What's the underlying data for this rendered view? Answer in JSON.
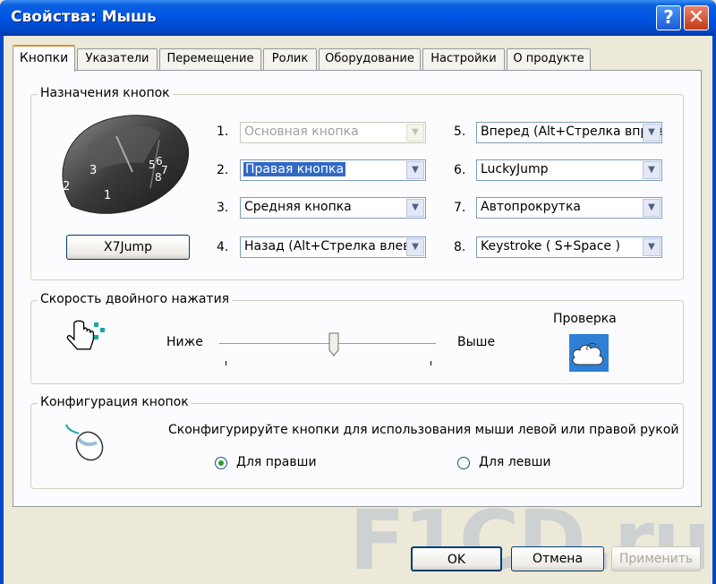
{
  "window": {
    "title": "Свойства: Мышь",
    "help_glyph": "?",
    "close_glyph": "✕"
  },
  "tabs": [
    {
      "label": "Кнопки",
      "active": true
    },
    {
      "label": "Указатели"
    },
    {
      "label": "Перемещение"
    },
    {
      "label": "Ролик"
    },
    {
      "label": "Оборудование"
    },
    {
      "label": "Настройки"
    },
    {
      "label": "О продукте"
    }
  ],
  "button_assignment": {
    "group_label": "Назначения кнопок",
    "mouse_image_labels": [
      "1",
      "2",
      "3",
      "5",
      "6",
      "7",
      "8"
    ],
    "profile_button": "X7Jump",
    "slots": [
      {
        "number": "1.",
        "value": "Основная кнопка",
        "state": "disabled"
      },
      {
        "number": "2.",
        "value": "Правая кнопка",
        "state": "selected"
      },
      {
        "number": "3.",
        "value": "Средняя кнопка",
        "state": "normal"
      },
      {
        "number": "4.",
        "value": "Назад (Alt+Стрелка влево)",
        "state": "normal"
      },
      {
        "number": "5.",
        "value": "Вперед (Alt+Стрелка вправо)",
        "state": "normal"
      },
      {
        "number": "6.",
        "value": "LuckyJump",
        "state": "normal"
      },
      {
        "number": "7.",
        "value": "Автопрокрутка",
        "state": "normal"
      },
      {
        "number": "8.",
        "value": "Keystroke ( S+Space )",
        "state": "normal"
      }
    ]
  },
  "double_click": {
    "group_label": "Скорость двойного нажатия",
    "slow_label": "Ниже",
    "fast_label": "Выше",
    "test_label": "Проверка",
    "speed_fraction": 0.53
  },
  "button_config": {
    "group_label": "Конфигурация кнопок",
    "description": "Сконфигурируйте кнопки для использования мыши левой или правой рукой",
    "options": [
      {
        "label": "Для правши",
        "checked": true
      },
      {
        "label": "Для левши",
        "checked": false
      }
    ]
  },
  "footer": {
    "ok": "OK",
    "cancel": "Отмена",
    "apply": "Применить"
  },
  "watermark": "F1CD.ru"
}
